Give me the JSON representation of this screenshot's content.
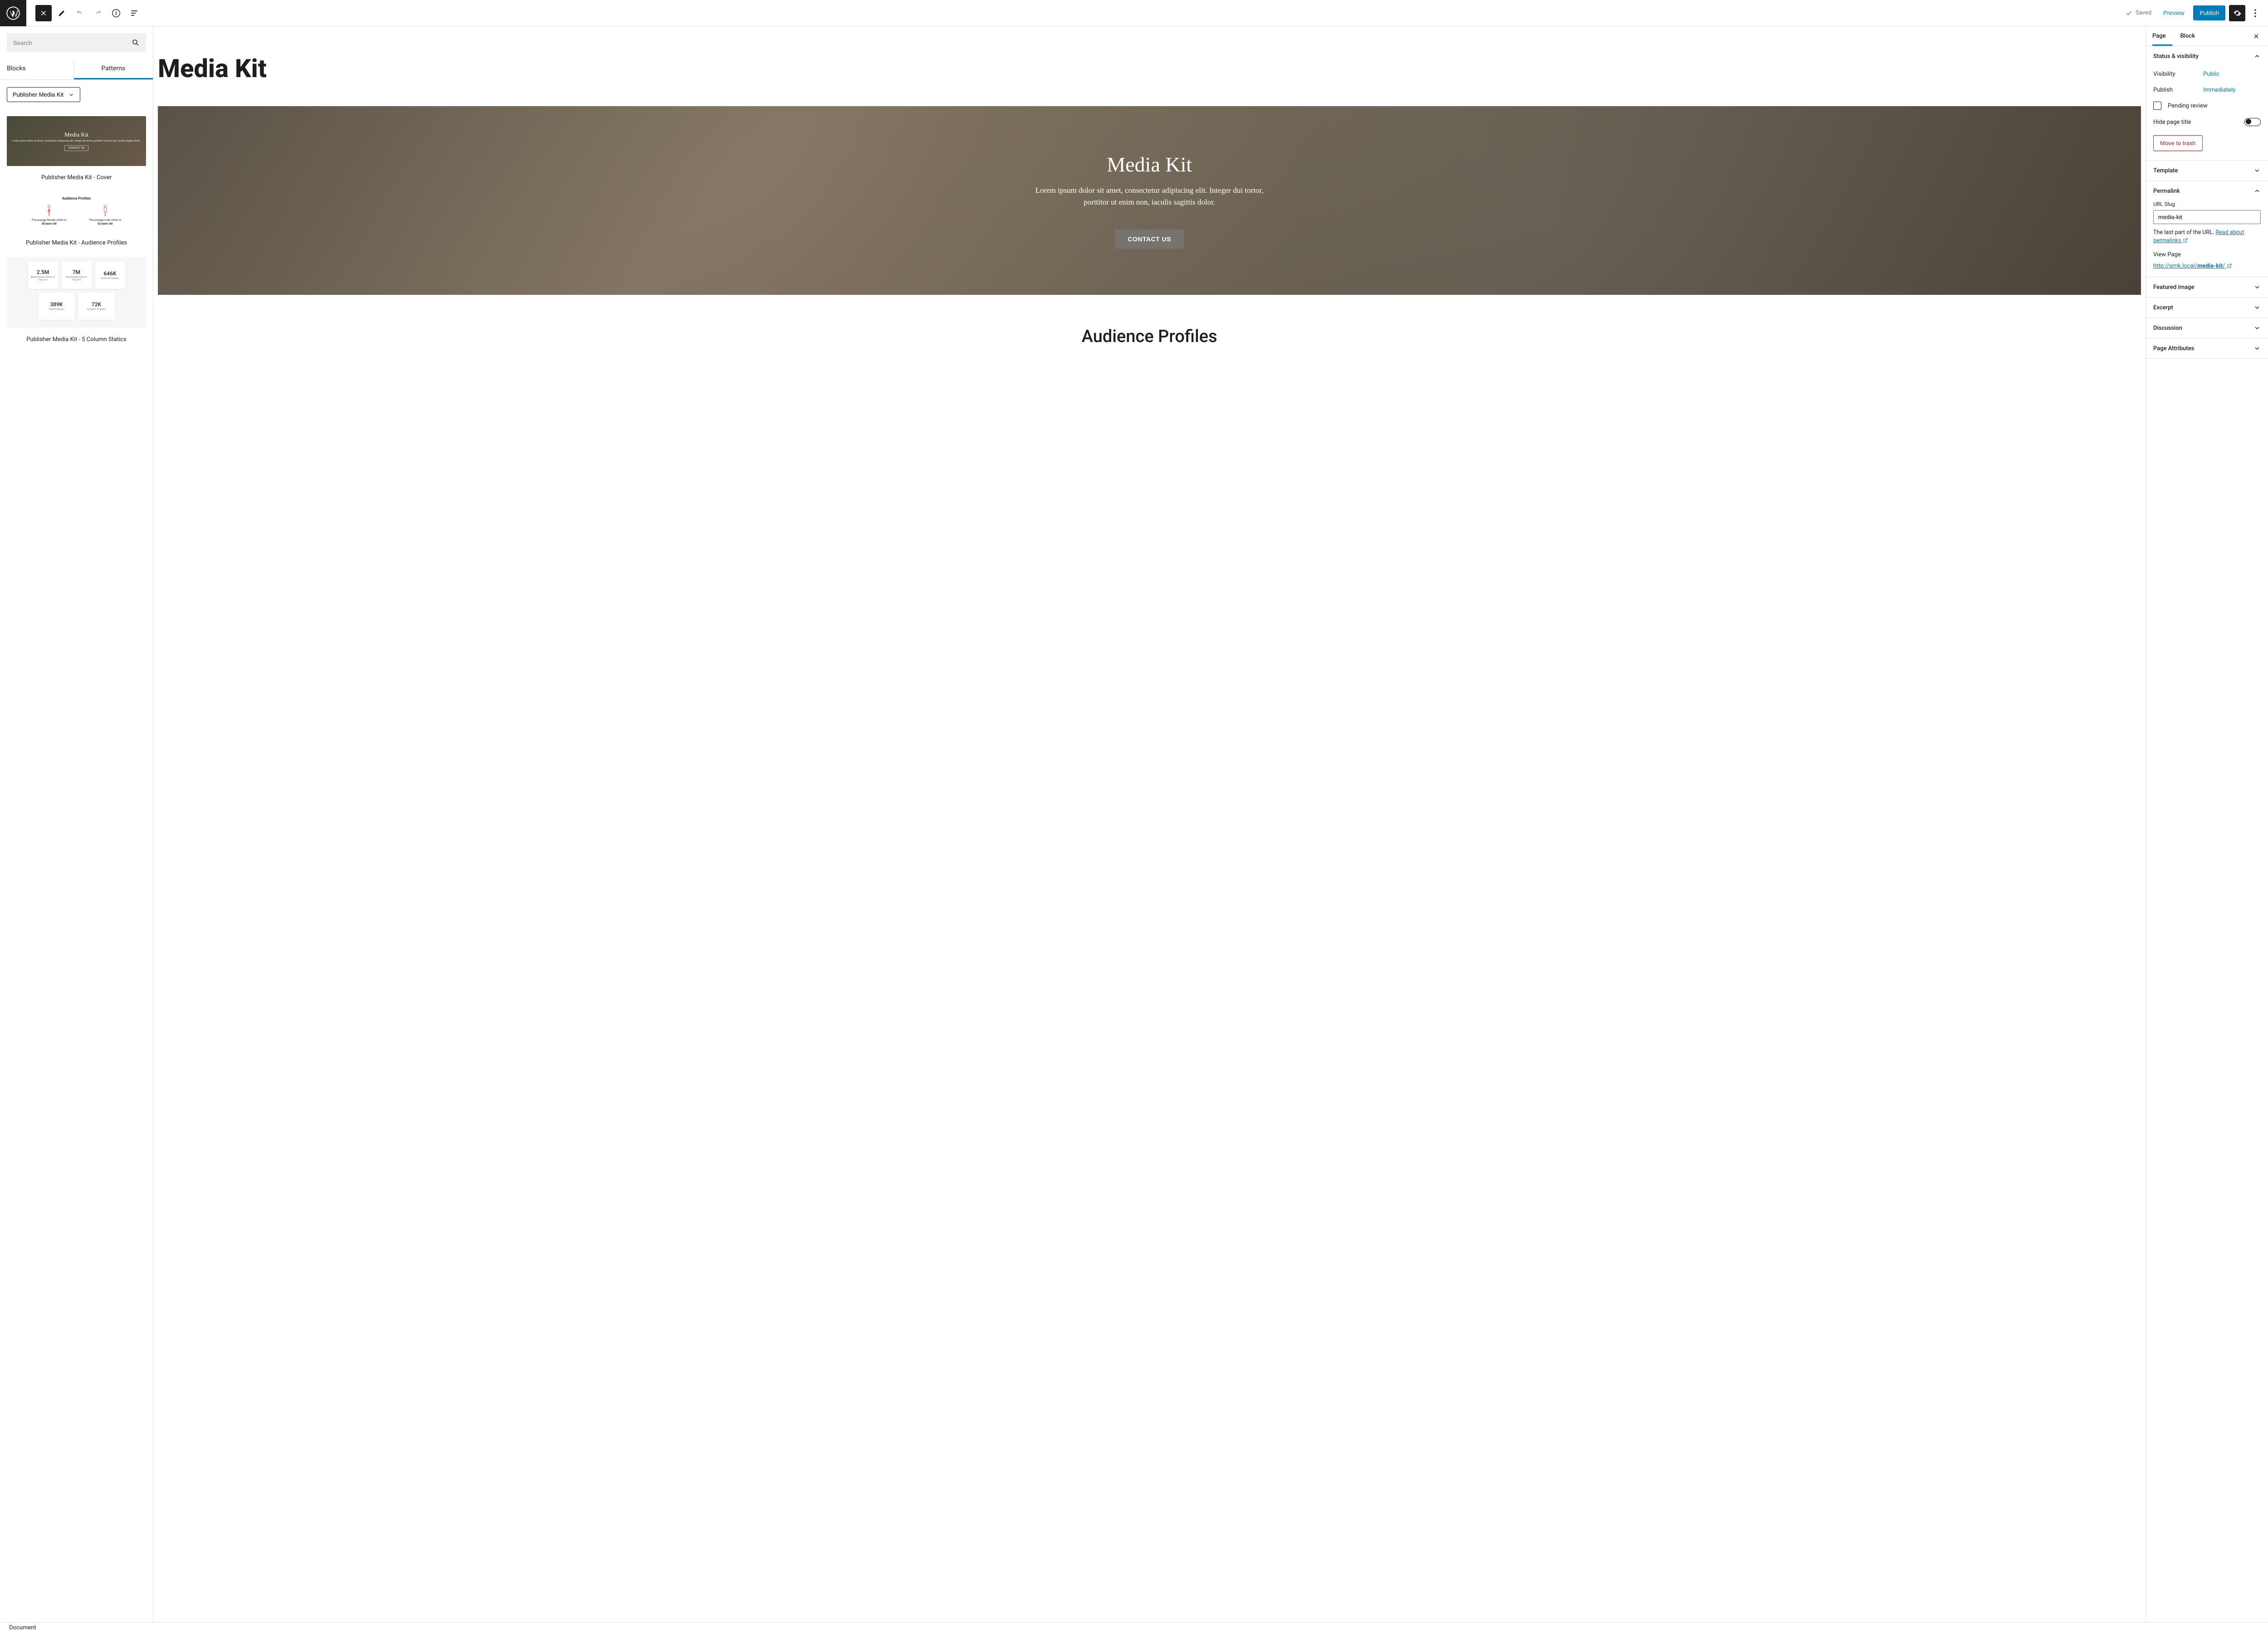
{
  "toolbar": {
    "saved": "Saved",
    "preview": "Preview",
    "publish": "Publish"
  },
  "leftSidebar": {
    "searchPlaceholder": "Search",
    "tabs": {
      "blocks": "Blocks",
      "patterns": "Patterns"
    },
    "categorySelected": "Publisher Media Kit",
    "patterns": {
      "cover": {
        "title": "Publisher Media Kit - Cover",
        "previewTitle": "Media Kit",
        "previewSub": "Lorem ipsum dolor sit amet, consectetur adipiscing elit. Integer dui tortor, porttitor ut enim non, iaculis sagittis dolor.",
        "previewBtn": "CONTACT US"
      },
      "audience": {
        "title": "Publisher Media Kit - Audience Profiles",
        "heading": "Audience Profiles",
        "female": "The average female visitor is",
        "femaleAge": "38 years old",
        "male": "The average male visitor is",
        "maleAge": "52 years old"
      },
      "stats": {
        "title": "Publisher Media Kit - 5 Column Statics",
        "cards": [
          {
            "num": "2.5M",
            "lbl": "Monthly Unique Visitors on 10up.com"
          },
          {
            "num": "7M",
            "lbl": "Monthly Page Views on 10up.com"
          },
          {
            "num": "646K",
            "lbl": "Facebook Followers"
          },
          {
            "num": "389K",
            "lbl": "Twitter Followers"
          },
          {
            "num": "72K",
            "lbl": "Instagram Followers"
          }
        ]
      }
    }
  },
  "canvas": {
    "pageTitle": "Media Kit",
    "cover": {
      "title": "Media Kit",
      "sub": "Lorem ipsum dolor sit amet, consectetur adipiscing elit. Integer dui tortor, porttitor ut enim non, iaculis sagittis dolor.",
      "cta": "CONTACT US"
    },
    "audienceHeading": "Audience Profiles"
  },
  "rightSidebar": {
    "tabs": {
      "page": "Page",
      "block": "Block"
    },
    "status": {
      "heading": "Status & visibility",
      "visibilityLabel": "Visibility",
      "visibilityValue": "Public",
      "publishLabel": "Publish",
      "publishValue": "Immediately",
      "pendingReview": "Pending review",
      "hidePageTitle": "Hide page title",
      "moveToTrash": "Move to trash"
    },
    "template": "Template",
    "permalink": {
      "heading": "Permalink",
      "slugLabel": "URL Slug",
      "slugValue": "media-kit",
      "help1": "The last part of the URL. ",
      "helpLink": "Read about permalinks",
      "viewPage": "View Page",
      "urlBase": "http://pmk.local/",
      "urlSlug": "media-kit",
      "urlSuffix": "/"
    },
    "featuredImage": "Featured image",
    "excerpt": "Excerpt",
    "discussion": "Discussion",
    "pageAttributes": "Page Attributes"
  },
  "footer": {
    "breadcrumb": "Document"
  }
}
